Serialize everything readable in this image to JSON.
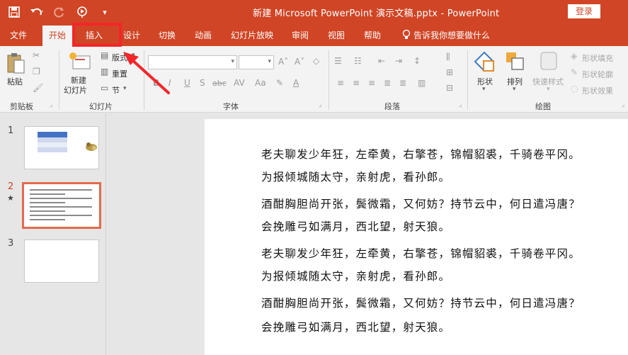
{
  "titlebar": {
    "title": "新建 Microsoft PowerPoint 演示文稿.pptx  -  PowerPoint",
    "login_label": "登录",
    "quick_access": [
      "save-icon",
      "undo-icon",
      "redo-icon",
      "present-icon",
      "customize-icon"
    ]
  },
  "tabs": [
    "文件",
    "开始",
    "插入",
    "设计",
    "切换",
    "动画",
    "幻灯片放映",
    "审阅",
    "视图",
    "帮助"
  ],
  "tell_me": "告诉我你想要做什么",
  "ribbon": {
    "clipboard": {
      "paste": "粘贴",
      "group": "剪贴板"
    },
    "slides": {
      "new_slide_line1": "新建",
      "new_slide_line2": "幻灯片",
      "layout": "版式",
      "reset": "重置",
      "section": "节",
      "group": "幻灯片"
    },
    "font": {
      "group": "字体",
      "bold": "B",
      "italic": "I",
      "underline": "U",
      "strike": "abc"
    },
    "paragraph": {
      "group": "段落"
    },
    "drawing": {
      "shape": "形状",
      "arrange": "排列",
      "quick_styles": "快速样式",
      "fill": "形状填充",
      "outline": "形状轮廓",
      "effects": "形状效果",
      "group": "绘图"
    }
  },
  "thumbnails": [
    {
      "number": "1"
    },
    {
      "number": "2",
      "selected": true,
      "star": "★"
    },
    {
      "number": "3"
    }
  ],
  "slide": {
    "lines": [
      "老夫聊发少年狂，左牵黄，右擎苍，锦帽貂裘，千骑卷平冈。",
      "为报倾城随太守，亲射虎，看孙郎。",
      "酒酣胸胆尚开张，鬓微霜，又何妨？持节云中，何日遣冯唐？",
      "会挽雕弓如满月，西北望，射天狼。",
      "老夫聊发少年狂，左牵黄，右擎苍，锦帽貂裘，千骑卷平冈。",
      "为报倾城随太守，亲射虎，看孙郎。",
      "酒酣胸胆尚开张，鬓微霜，又何妨？持节云中，何日遣冯唐？",
      "会挽雕弓如满月，西北望，射天狼。"
    ]
  },
  "colors": {
    "accent": "#d04525",
    "highlight": "#f2262a",
    "selection": "#e36b4b"
  }
}
